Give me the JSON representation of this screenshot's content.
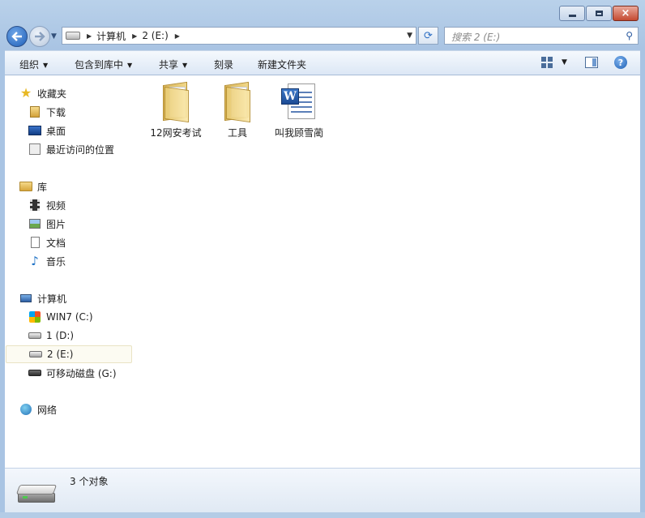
{
  "window": {
    "caption_buttons": {
      "minimize_icon": "minimize-icon",
      "maximize_icon": "maximize-icon",
      "close_label": "×"
    }
  },
  "nav": {
    "breadcrumbs": [
      "计算机",
      "2 (E:)"
    ],
    "search_placeholder": "搜索 2 (E:)",
    "refresh_icon": "refresh-icon"
  },
  "toolbar": {
    "organize": "组织",
    "include_in_library": "包含到库中",
    "share": "共享",
    "burn": "刻录",
    "new_folder": "新建文件夹"
  },
  "sidebar": {
    "favorites": {
      "label": "收藏夹",
      "items": [
        "下载",
        "桌面",
        "最近访问的位置"
      ]
    },
    "libraries": {
      "label": "库",
      "items": [
        "视频",
        "图片",
        "文档",
        "音乐"
      ]
    },
    "computer": {
      "label": "计算机",
      "items": [
        "WIN7 (C:)",
        "1 (D:)",
        "2 (E:)",
        "可移动磁盘 (G:)"
      ],
      "selected": "2 (E:)"
    },
    "network": {
      "label": "网络"
    }
  },
  "files": [
    {
      "name": "12网安考试",
      "type": "folder"
    },
    {
      "name": "工具",
      "type": "folder"
    },
    {
      "name": "叫我顾雪蔺",
      "type": "word-document"
    }
  ],
  "details": {
    "status": "3 个对象"
  },
  "colors": {
    "frame": "#b9d1ea",
    "selected_bg": "#fcfbf2",
    "accent": "#1f5fb8"
  }
}
